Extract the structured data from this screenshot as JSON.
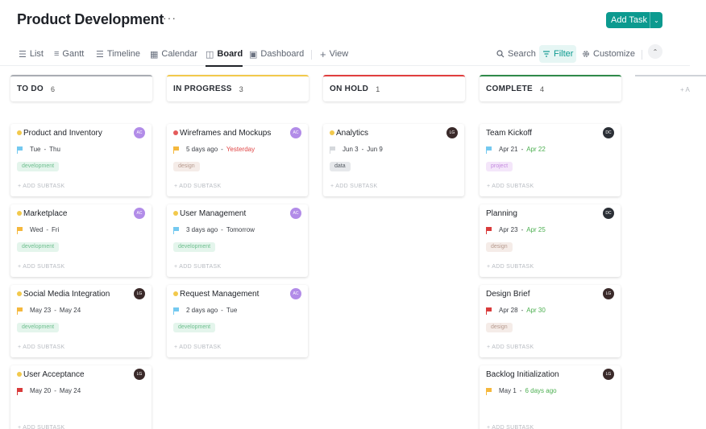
{
  "header": {
    "title": "Product Development",
    "more": "···",
    "add_task": "Add Task",
    "add_task_caret": "⌄"
  },
  "views": [
    {
      "label": "List",
      "icon": "list-icon",
      "glyph": "☰"
    },
    {
      "label": "Gantt",
      "icon": "gantt-icon",
      "glyph": "≡"
    },
    {
      "label": "Timeline",
      "icon": "timeline-icon",
      "glyph": "☰"
    },
    {
      "label": "Calendar",
      "icon": "calendar-icon",
      "glyph": "▦"
    },
    {
      "label": "Board",
      "icon": "board-icon",
      "glyph": "◫",
      "active": true
    },
    {
      "label": "Dashboard",
      "icon": "dashboard-icon",
      "glyph": "▣"
    },
    {
      "label": "View",
      "icon": "plus-icon",
      "glyph": "+"
    }
  ],
  "tools": {
    "search": "Search",
    "filter": "Filter",
    "customize": "Customize",
    "collapse": "⌃"
  },
  "columns": [
    {
      "name": "TO DO",
      "count": "6",
      "color": "#a9adb3"
    },
    {
      "name": "IN PROGRESS",
      "count": "3",
      "color": "#f2c94c"
    },
    {
      "name": "ON HOLD",
      "count": "1",
      "color": "#e03e3e"
    },
    {
      "name": "COMPLETE",
      "count": "4",
      "color": "#2f8a4a"
    }
  ],
  "ghost_column": "+ A",
  "add_subtask": "+ ADD SUBTASK",
  "colors": {
    "accent": "#0c9a8f",
    "status_todo_dot": "#f2c94c",
    "status_progress_dot": "#e45b5b",
    "flag_blue": "#74c9f0",
    "flag_yellow": "#f5b83d",
    "flag_red": "#d93b3b",
    "flag_gray": "#d5d8dc",
    "date_red": "#e04646",
    "date_green": "#4caf50"
  },
  "cards": [
    {
      "col": 0,
      "row": 0,
      "name": "Product and Inventory",
      "dot": "#f2c94c",
      "avatar": "AC",
      "avatar_color": "#b28ce8",
      "flag": "#74c9f0",
      "start": "Tue",
      "end": "Thu",
      "end_color": "#3b3f46",
      "tag": "development",
      "tag_bg": "#e4f5ec",
      "tag_fg": "#6fbf8f"
    },
    {
      "col": 0,
      "row": 1,
      "name": "Marketplace",
      "dot": "#f2c94c",
      "avatar": "AC",
      "avatar_color": "#b28ce8",
      "flag": "#f5b83d",
      "start": "Wed",
      "end": "Fri",
      "end_color": "#3b3f46",
      "tag": "development",
      "tag_bg": "#e4f5ec",
      "tag_fg": "#6fbf8f"
    },
    {
      "col": 0,
      "row": 2,
      "name": "Social Media Integration",
      "dot": "#f2c94c",
      "avatar": "LG",
      "avatar_color": "#3a2a2a",
      "flag": "#f5b83d",
      "start": "May 23",
      "end": "May 24",
      "end_color": "#3b3f46",
      "tag": "development",
      "tag_bg": "#e4f5ec",
      "tag_fg": "#6fbf8f"
    },
    {
      "col": 0,
      "row": 3,
      "name": "User Acceptance",
      "dot": "#f2c94c",
      "avatar": "LG",
      "avatar_color": "#3a2a2a",
      "flag": "#d93b3b",
      "start": "May 20",
      "end": "May 24",
      "end_color": "#3b3f46",
      "tag": "",
      "tag_bg": "",
      "tag_fg": ""
    },
    {
      "col": 1,
      "row": 0,
      "name": "Wireframes and Mockups",
      "dot": "#e45b5b",
      "avatar": "AC",
      "avatar_color": "#b28ce8",
      "flag": "#f5b83d",
      "start": "5 days ago",
      "end": "Yesterday",
      "end_color": "#e04646",
      "tag": "design",
      "tag_bg": "#f5ece8",
      "tag_fg": "#b69a8e"
    },
    {
      "col": 1,
      "row": 1,
      "name": "User Management",
      "dot": "#f2c94c",
      "avatar": "AC",
      "avatar_color": "#b28ce8",
      "flag": "#74c9f0",
      "start": "3 days ago",
      "end": "Tomorrow",
      "end_color": "#3b3f46",
      "tag": "development",
      "tag_bg": "#e4f5ec",
      "tag_fg": "#6fbf8f"
    },
    {
      "col": 1,
      "row": 2,
      "name": "Request Management",
      "dot": "#f2c94c",
      "avatar": "AC",
      "avatar_color": "#b28ce8",
      "flag": "#74c9f0",
      "start": "2 days ago",
      "end": "Tue",
      "end_color": "#3b3f46",
      "tag": "development",
      "tag_bg": "#e4f5ec",
      "tag_fg": "#6fbf8f"
    },
    {
      "col": 2,
      "row": 0,
      "name": "Analytics",
      "dot": "#f2c94c",
      "avatar": "LG",
      "avatar_color": "#3a2a2a",
      "flag": "#d5d8dc",
      "start": "Jun 3",
      "end": "Jun 9",
      "end_color": "#3b3f46",
      "tag": "data",
      "tag_bg": "#e6e8eb",
      "tag_fg": "#555b63"
    },
    {
      "col": 3,
      "row": 0,
      "name": "Team Kickoff",
      "dot": "",
      "avatar": "DC",
      "avatar_color": "#2b2f36",
      "flag": "#74c9f0",
      "start": "Apr 21",
      "end": "Apr 22",
      "end_color": "#4caf50",
      "tag": "project",
      "tag_bg": "#f4e6fa",
      "tag_fg": "#c58be0"
    },
    {
      "col": 3,
      "row": 1,
      "name": "Planning",
      "dot": "",
      "avatar": "DC",
      "avatar_color": "#2b2f36",
      "flag": "#d93b3b",
      "start": "Apr 23",
      "end": "Apr 25",
      "end_color": "#4caf50",
      "tag": "design",
      "tag_bg": "#f5ece8",
      "tag_fg": "#b69a8e"
    },
    {
      "col": 3,
      "row": 2,
      "name": "Design Brief",
      "dot": "",
      "avatar": "LG",
      "avatar_color": "#3a2a2a",
      "flag": "#d93b3b",
      "start": "Apr 28",
      "end": "Apr 30",
      "end_color": "#4caf50",
      "tag": "design",
      "tag_bg": "#f5ece8",
      "tag_fg": "#b69a8e"
    },
    {
      "col": 3,
      "row": 3,
      "name": "Backlog Initialization",
      "dot": "",
      "avatar": "LG",
      "avatar_color": "#3a2a2a",
      "flag": "#f5b83d",
      "start": "May 1",
      "end": "6 days ago",
      "end_color": "#4caf50",
      "tag": "",
      "tag_bg": "",
      "tag_fg": ""
    }
  ]
}
